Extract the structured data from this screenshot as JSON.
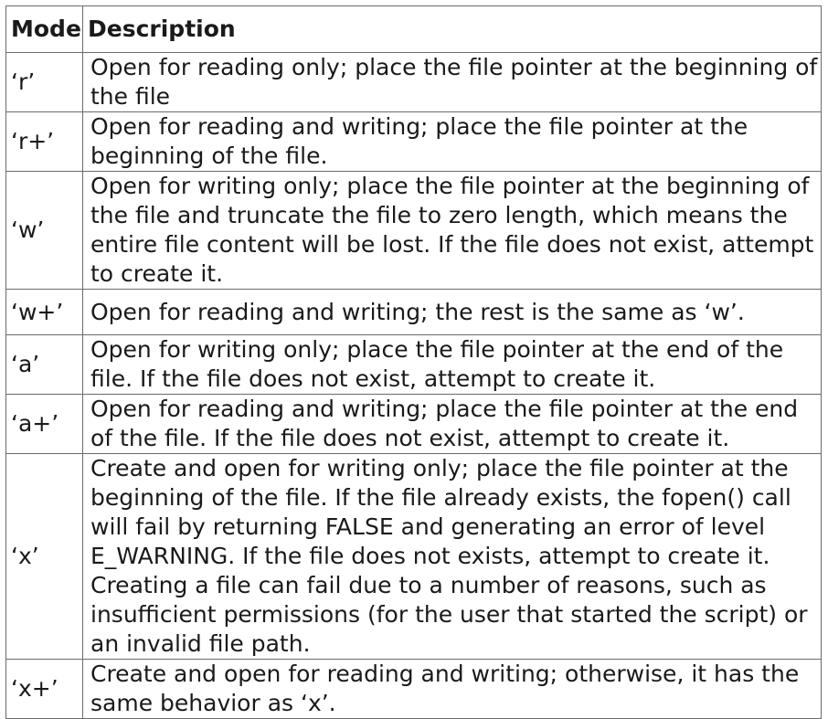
{
  "table": {
    "headers": {
      "mode": "Mode",
      "description": "Description"
    },
    "rows": [
      {
        "mode": "‘r’",
        "description": "Open for reading only; place the file pointer at the beginning of the file"
      },
      {
        "mode": "‘r+’",
        "description": "Open for reading and writing; place the file pointer at the beginning of the file."
      },
      {
        "mode": "‘w’",
        "description": "Open for writing only; place the file pointer at the beginning of the file and truncate the file to zero length, which means the entire file content will be lost. If the file does not exist, attempt to create it."
      },
      {
        "mode": "‘w+’",
        "description": "Open for reading and writing; the rest is the same as ‘w’."
      },
      {
        "mode": "‘a’",
        "description": "Open for writing only; place the file pointer at the end of the file. If the file does not exist, attempt to create it."
      },
      {
        "mode": "‘a+’",
        "description": "Open for reading and writing; place the file pointer at the end of the file. If the file does not exist, attempt to create it."
      },
      {
        "mode": "‘x’",
        "description": "Create and open for writing only; place the file pointer at the beginning of the file. If the file already exists, the fopen() call will fail by returning FALSE and generating an error of level E_WARNING. If the file does not exists, attempt to create it. Creating a file can fail due to a number of reasons, such as insufficient permissions (for the user that started the script) or an invalid file path."
      },
      {
        "mode": "‘x+’",
        "description": "Create and open for reading and writing; otherwise, it has the same behavior as ‘x’."
      }
    ]
  }
}
